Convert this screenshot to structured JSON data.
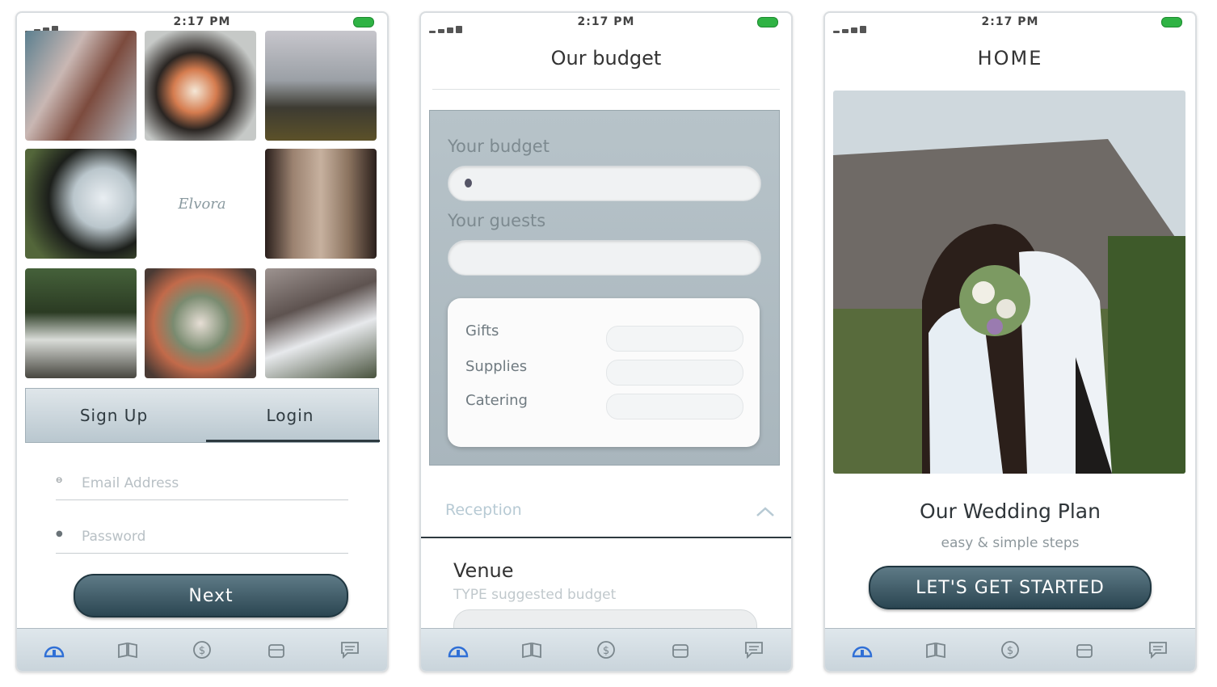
{
  "status": {
    "time": "2:17 PM"
  },
  "screen1": {
    "logo": "Elvora",
    "segments": [
      "Sign Up",
      "Login"
    ],
    "email_placeholder": "Email Address",
    "password_placeholder": "Password",
    "next_label": "Next"
  },
  "screen2": {
    "title": "Our budget",
    "budget_label": "Your budget",
    "guests_label": "Your guests",
    "inner_labels": [
      "Gifts",
      "Supplies",
      "Catering"
    ],
    "section_label": "Reception",
    "venue_title": "Venue",
    "venue_sub": "TYPE suggested budget"
  },
  "screen3": {
    "title": "HOME",
    "plan_title": "Our Wedding Plan",
    "plan_sub": "easy & simple steps",
    "start_label": "LET'S GET STARTED"
  },
  "tabs": [
    "home-icon",
    "book-icon",
    "dollar-icon",
    "gift-icon",
    "chat-icon"
  ],
  "colors": {
    "accent_dark": "#2b4652",
    "active_tab": "#2f6fd6",
    "battery": "#2fb344"
  }
}
